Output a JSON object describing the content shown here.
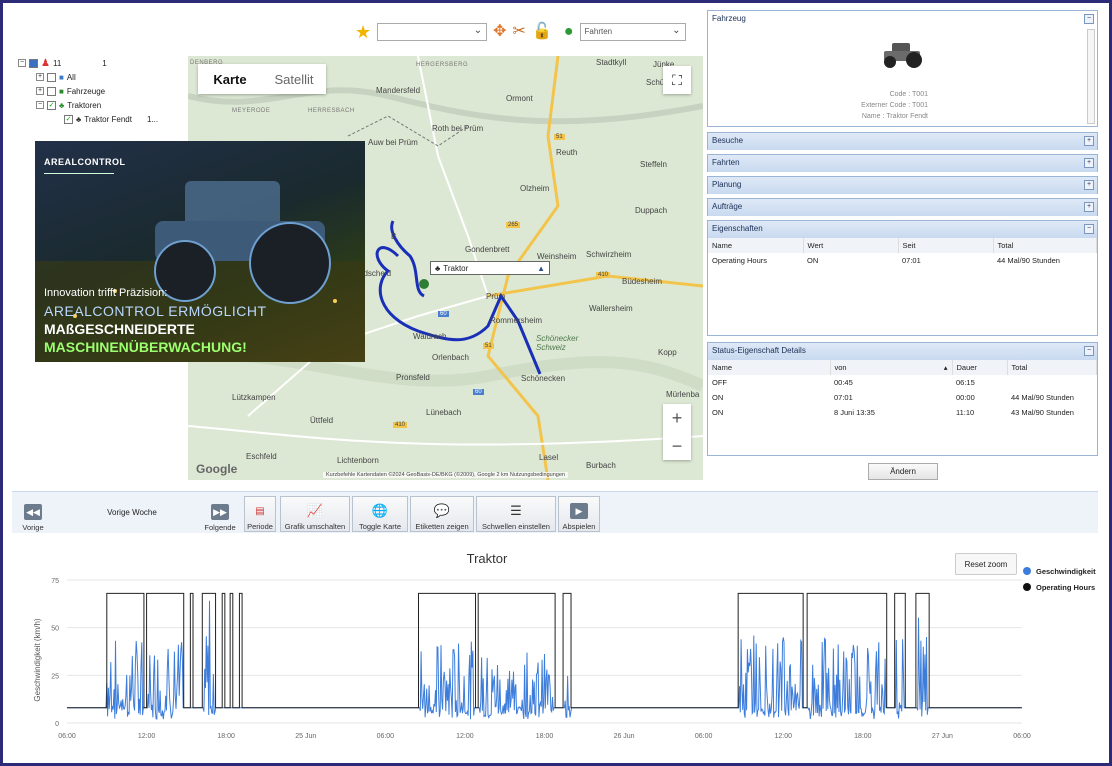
{
  "colors": {
    "frame": "#2d2a78",
    "route": "#1a2fb8",
    "speed": "#3c7ddb",
    "hours": "#222222",
    "panel_head": "#c8d9ef"
  },
  "toolbar_top": {
    "trip_select": "Fahrten"
  },
  "tree": {
    "root_label": "11",
    "root_count": "1",
    "items": [
      {
        "label": "All",
        "icon": "car-group-icon"
      },
      {
        "label": "Fahrzeuge",
        "icon": "truck-icon"
      },
      {
        "label": "Traktoren",
        "icon": "tractor-icon"
      },
      {
        "label": "Traktor Fendt",
        "suffix": "1..."
      }
    ]
  },
  "map": {
    "tab_map": "Karte",
    "tab_satellite": "Satellit",
    "marker_label": "Traktor",
    "footer": "Kurzbefehle   Kartendaten ©2024 GeoBasis-DE/BKG (©2009), Google   2 km   Nutzungsbedingungen",
    "google": "Google",
    "zoom_in": "+",
    "zoom_out": "−",
    "places": [
      "Stadtkyll",
      "Jünke",
      "Schü",
      "Mandersfeld",
      "Ormont",
      "Roth bei Prüm",
      "Auw bei Prüm",
      "Reuth",
      "Steffeln",
      "Olzheim",
      "Duppach",
      "Gondenbrett",
      "Weinsheim",
      "Schwirzheim",
      "Büdesheim",
      "Prüm",
      "Rommersheim",
      "Wallersheim",
      "Waldrach",
      "Orlenbach",
      "Schönecker Schweiz",
      "Kopp",
      "Pronsfeld",
      "Schönecken",
      "Mürlenba",
      "Lützkampen",
      "Lünebach",
      "Üttfeld",
      "Eschfeld",
      "Lichtenborn",
      "Lasel",
      "Burbach",
      "ndscheid",
      "B"
    ],
    "places_small": [
      "DENBERG",
      "HERGERSBERG",
      "HERRESBACH",
      "MEYERODE"
    ],
    "roads": [
      "51",
      "265",
      "410",
      "60",
      "51",
      "410",
      "60"
    ]
  },
  "ad": {
    "logo": "AREALCONTROL",
    "line1": "Innovation trifft Präzision:",
    "line2": "AREALCONTROL ERMÖGLICHT",
    "line3": "MAßGESCHNEIDERTE",
    "line4": "MASCHINENÜBERWACHUNG!"
  },
  "vehicle_panel": {
    "title": "Fahrzeug",
    "code_label": "Code :",
    "code": "T001",
    "extcode_label": "Externer Code :",
    "extcode": "T001",
    "name_label": "Name :",
    "name": "Traktor Fendt"
  },
  "collapsed_panels": [
    "Besuche",
    "Fahrten",
    "Planung",
    "Aufträge"
  ],
  "properties_panel": {
    "title": "Eigenschaften",
    "headers": [
      "Name",
      "Wert",
      "Seit",
      "Total"
    ],
    "rows": [
      [
        "Operating Hours",
        "ON",
        "07:01",
        "44 Mal/90 Stunden"
      ]
    ]
  },
  "status_panel": {
    "title": "Status-Eigenschaft Details",
    "headers": [
      "Name",
      "von",
      "Dauer",
      "Total"
    ],
    "rows": [
      [
        "OFF",
        "00:45",
        "06:15",
        ""
      ],
      [
        "ON",
        "07:01",
        "00:00",
        "44 Mal/90 Stunden"
      ],
      [
        "ON",
        "8 Juni 13:35",
        "11:10",
        "43 Mal/90 Stunden"
      ]
    ]
  },
  "change_button": "Ändern",
  "bottom_toolbar": {
    "prev": "Vorige",
    "period_text": "Vorige Woche",
    "next": "Folgende",
    "period": "Periode",
    "toggle_chart": "Grafik umschalten",
    "toggle_map": "Toggle Karte",
    "labels": "Etiketten zeigen",
    "thresholds": "Schwellen einstellen",
    "play": "Abspielen"
  },
  "chart_data": {
    "type": "line",
    "title": "Traktor",
    "ylabel": "Geschwindigkeit (km/h)",
    "xlabel": "",
    "ylim": [
      0,
      75
    ],
    "yticks": [
      0,
      25,
      50,
      75
    ],
    "xticks": [
      "06:00",
      "12:00",
      "18:00",
      "25 Jun",
      "06:00",
      "12:00",
      "18:00",
      "26 Jun",
      "06:00",
      "12:00",
      "18:00",
      "27 Jun",
      "06:00"
    ],
    "grid": "horizontal",
    "legend_position": "top-right",
    "reset_zoom": "Reset zoom",
    "series": [
      {
        "name": "Geschwindigkeit",
        "style": "line"
      },
      {
        "name": "Operating Hours",
        "style": "step"
      }
    ],
    "x_range_hours": [
      0,
      72
    ],
    "baseline": 8,
    "on_level": 68,
    "operating_on_intervals": [
      [
        3.0,
        5.8
      ],
      [
        6.0,
        8.8
      ],
      [
        9.3,
        9.5
      ],
      [
        10.2,
        11.2
      ],
      [
        11.7,
        11.9
      ],
      [
        12.3,
        12.5
      ],
      [
        13.0,
        13.2
      ],
      [
        26.5,
        30.8
      ],
      [
        31.0,
        36.8
      ],
      [
        37.4,
        38.0
      ],
      [
        50.6,
        55.5
      ],
      [
        55.8,
        61.8
      ],
      [
        62.4,
        63.2
      ],
      [
        64.0,
        65.0
      ]
    ],
    "speed_bursts": [
      [
        3.0,
        5.7,
        40
      ],
      [
        6.1,
        8.7,
        38
      ],
      [
        10.3,
        11.2,
        60
      ],
      [
        26.6,
        30.7,
        38
      ],
      [
        31.1,
        36.7,
        32
      ],
      [
        37.5,
        38.0,
        62
      ],
      [
        50.7,
        55.4,
        42
      ],
      [
        55.9,
        61.7,
        40
      ],
      [
        62.5,
        63.1,
        55
      ],
      [
        64.1,
        64.9,
        60
      ]
    ]
  }
}
